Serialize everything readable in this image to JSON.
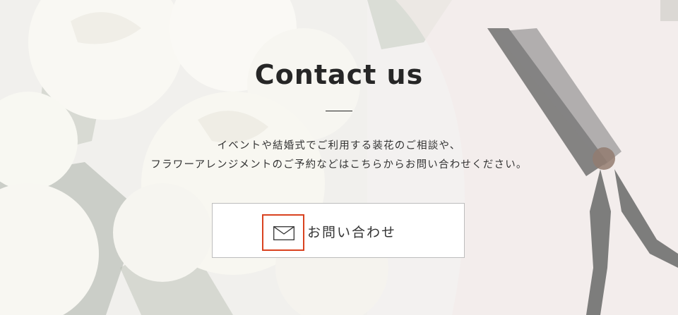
{
  "contact": {
    "title": "Contact us",
    "description": [
      "イベントや結婚式でご利用する装花のご相談や、",
      "フラワーアレンジメントのご予約などはこちらからお問い合わせください。"
    ]
  },
  "button": {
    "label": "お問い合わせ",
    "icon": "mail-icon",
    "highlight_color": "#d9421f"
  },
  "colors": {
    "text": "#262626",
    "button_bg": "#ffffff",
    "button_border": "#bdbdbd"
  }
}
